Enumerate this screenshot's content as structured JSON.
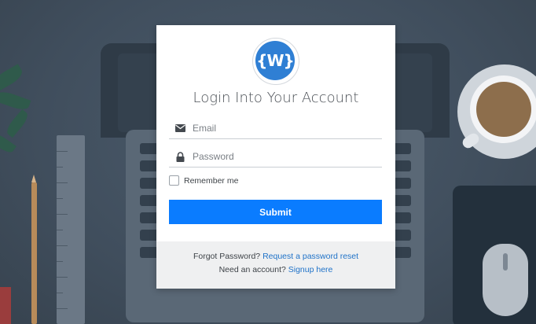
{
  "brand": {
    "logo_text": "{W}",
    "accent": "#0a7cff"
  },
  "form": {
    "title": "Login Into Your Account",
    "email": {
      "icon": "envelope-icon",
      "placeholder": "Email",
      "value": ""
    },
    "password": {
      "icon": "lock-icon",
      "placeholder": "Password",
      "value": ""
    },
    "remember_label": "Remember me",
    "remember_checked": false,
    "submit_label": "Submit"
  },
  "footer": {
    "forgot_text": "Forgot Password?",
    "forgot_link": "Request a password reset",
    "account_text": "Need an account?",
    "signup_link": "Signup here"
  }
}
